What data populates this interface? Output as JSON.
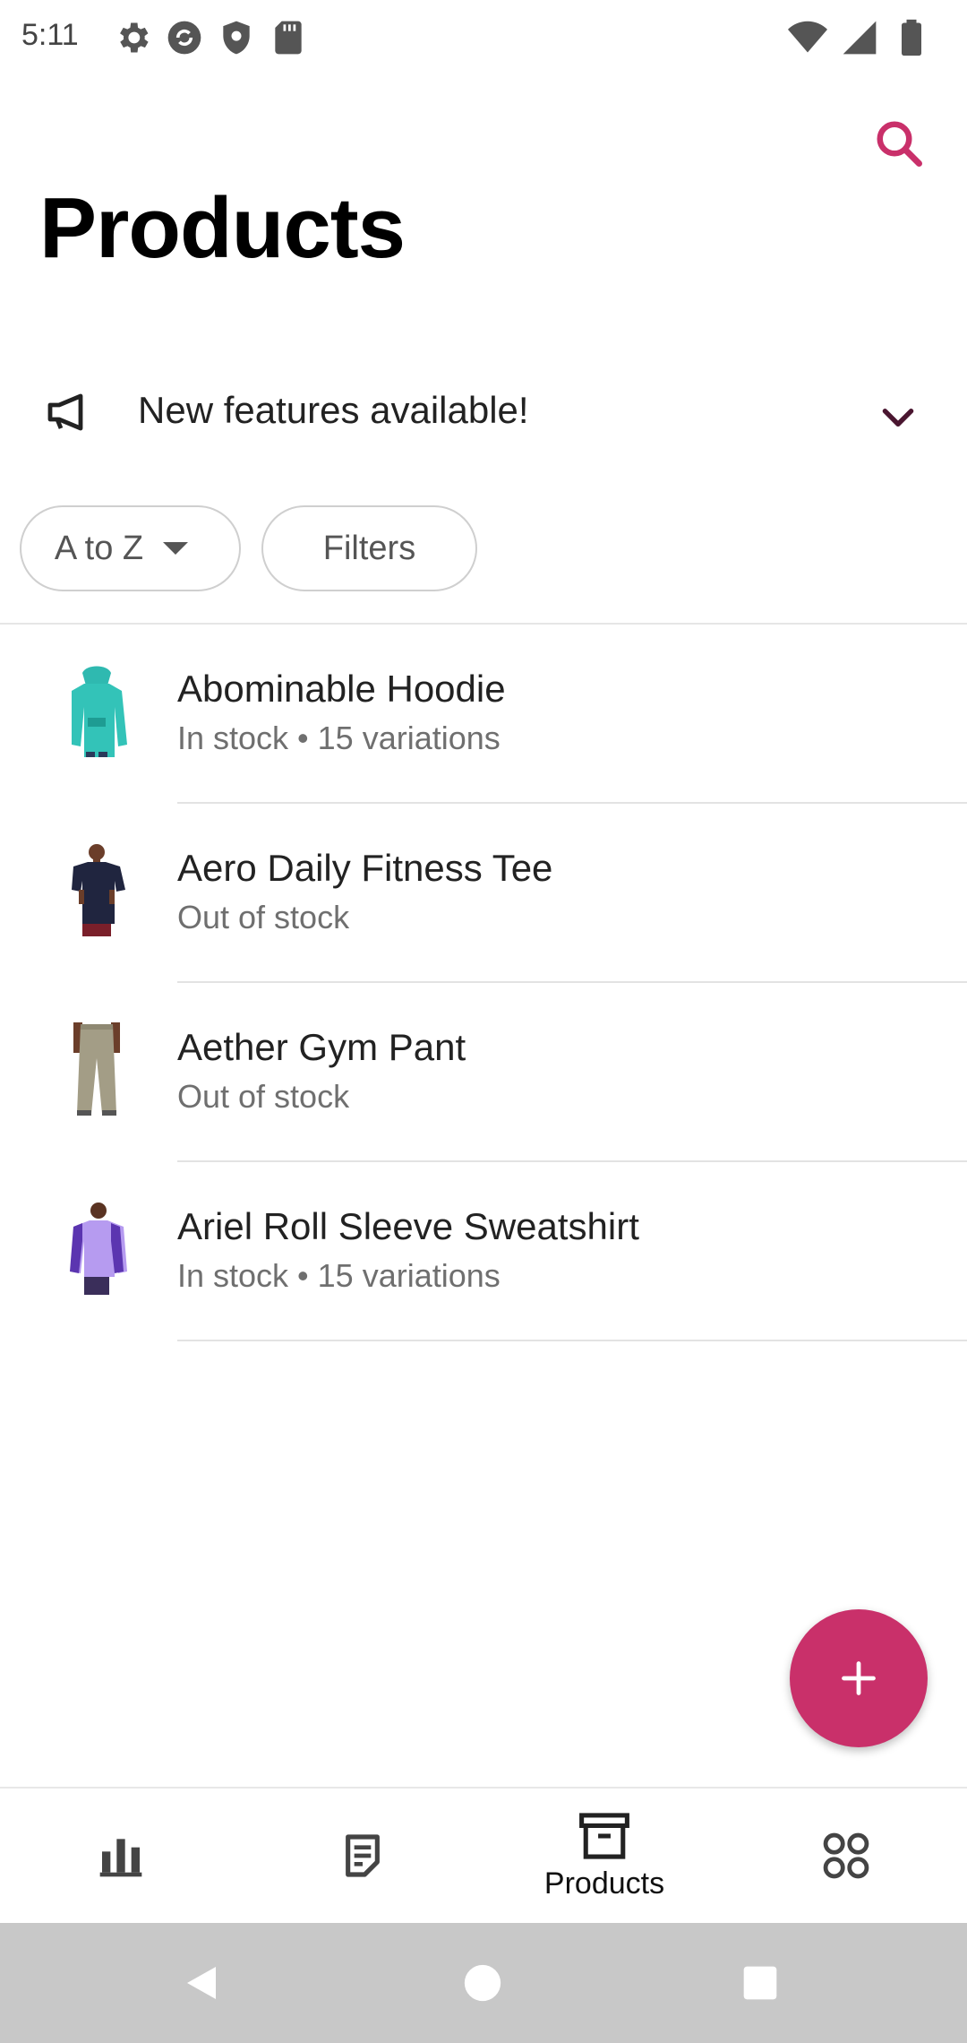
{
  "status_bar": {
    "time": "5:11",
    "icons_left": [
      "settings-icon",
      "sync-icon",
      "shield-icon",
      "sd-card-icon"
    ],
    "icons_right": [
      "wifi-icon",
      "cell-signal-icon",
      "battery-icon"
    ]
  },
  "header": {
    "title": "Products",
    "search_icon": "search-icon",
    "accent_color": "#c9306a"
  },
  "feature_banner": {
    "text": "New features available!",
    "icon": "megaphone-icon",
    "expand_icon": "chevron-down-icon"
  },
  "filters": {
    "sort_label": "A to Z",
    "filters_label": "Filters"
  },
  "products": [
    {
      "name": "Abominable Hoodie",
      "status": "In stock • 15 variations"
    },
    {
      "name": "Aero Daily Fitness Tee",
      "status": "Out of stock"
    },
    {
      "name": "Aether Gym Pant",
      "status": "Out of stock"
    },
    {
      "name": "Ariel Roll Sleeve Sweatshirt",
      "status": "In stock • 15 variations"
    }
  ],
  "fab": {
    "icon": "plus-icon"
  },
  "bottom_nav": {
    "items": [
      {
        "icon": "bar-chart-icon",
        "label": ""
      },
      {
        "icon": "orders-icon",
        "label": ""
      },
      {
        "icon": "products-box-icon",
        "label": "Products"
      },
      {
        "icon": "menu-grid-icon",
        "label": ""
      }
    ]
  },
  "system_nav": {
    "buttons": [
      "back-icon",
      "home-icon",
      "recents-icon"
    ]
  }
}
